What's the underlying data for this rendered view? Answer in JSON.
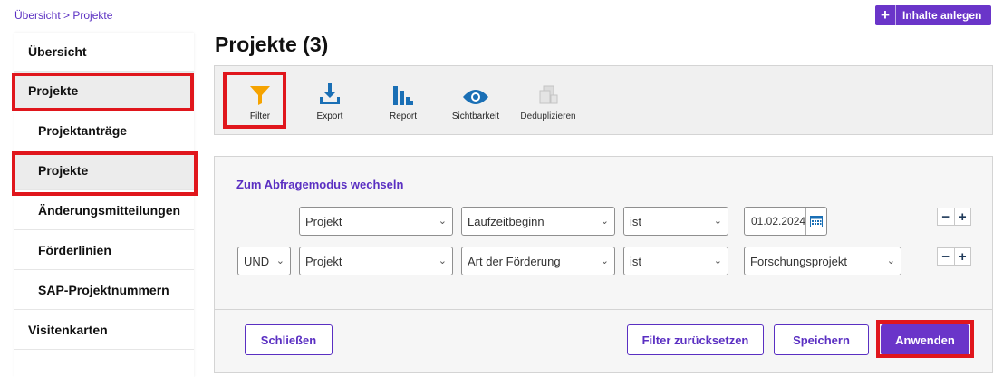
{
  "breadcrumb": {
    "home": "Übersicht",
    "sep": " > ",
    "current": "Projekte"
  },
  "header": {
    "create_label": "Inhalte anlegen",
    "create_icon": "plus-icon"
  },
  "sidebar": {
    "items": [
      {
        "label": "Übersicht"
      },
      {
        "label": "Projekte"
      },
      {
        "label": "Projektanträge"
      },
      {
        "label": "Projekte"
      },
      {
        "label": "Änderungsmitteilungen"
      },
      {
        "label": "Förderlinien"
      },
      {
        "label": "SAP-Projektnummern"
      },
      {
        "label": "Visitenkarten"
      }
    ]
  },
  "main": {
    "title": "Projekte (3)"
  },
  "toolbar": {
    "filter": "Filter",
    "export": "Export",
    "report": "Report",
    "visibility": "Sichtbarkeit",
    "dedup": "Deduplizieren"
  },
  "filter": {
    "query_mode_link": "Zum Abfragemodus wechseln",
    "rows": [
      {
        "connector": "",
        "entity": "Projekt",
        "field": "Laufzeitbeginn",
        "operator": "ist",
        "value": "01.02.2024"
      },
      {
        "connector": "UND",
        "entity": "Projekt",
        "field": "Art der Förderung",
        "operator": "ist",
        "value": "Forschungsprojekt"
      }
    ],
    "buttons": {
      "close": "Schließen",
      "reset": "Filter zurücksetzen",
      "save": "Speichern",
      "apply": "Anwenden"
    }
  },
  "colors": {
    "accent": "#6a35c9",
    "highlight": "#e0161c",
    "filter_icon": "#f5a300",
    "icon_blue": "#1a6fb5"
  }
}
